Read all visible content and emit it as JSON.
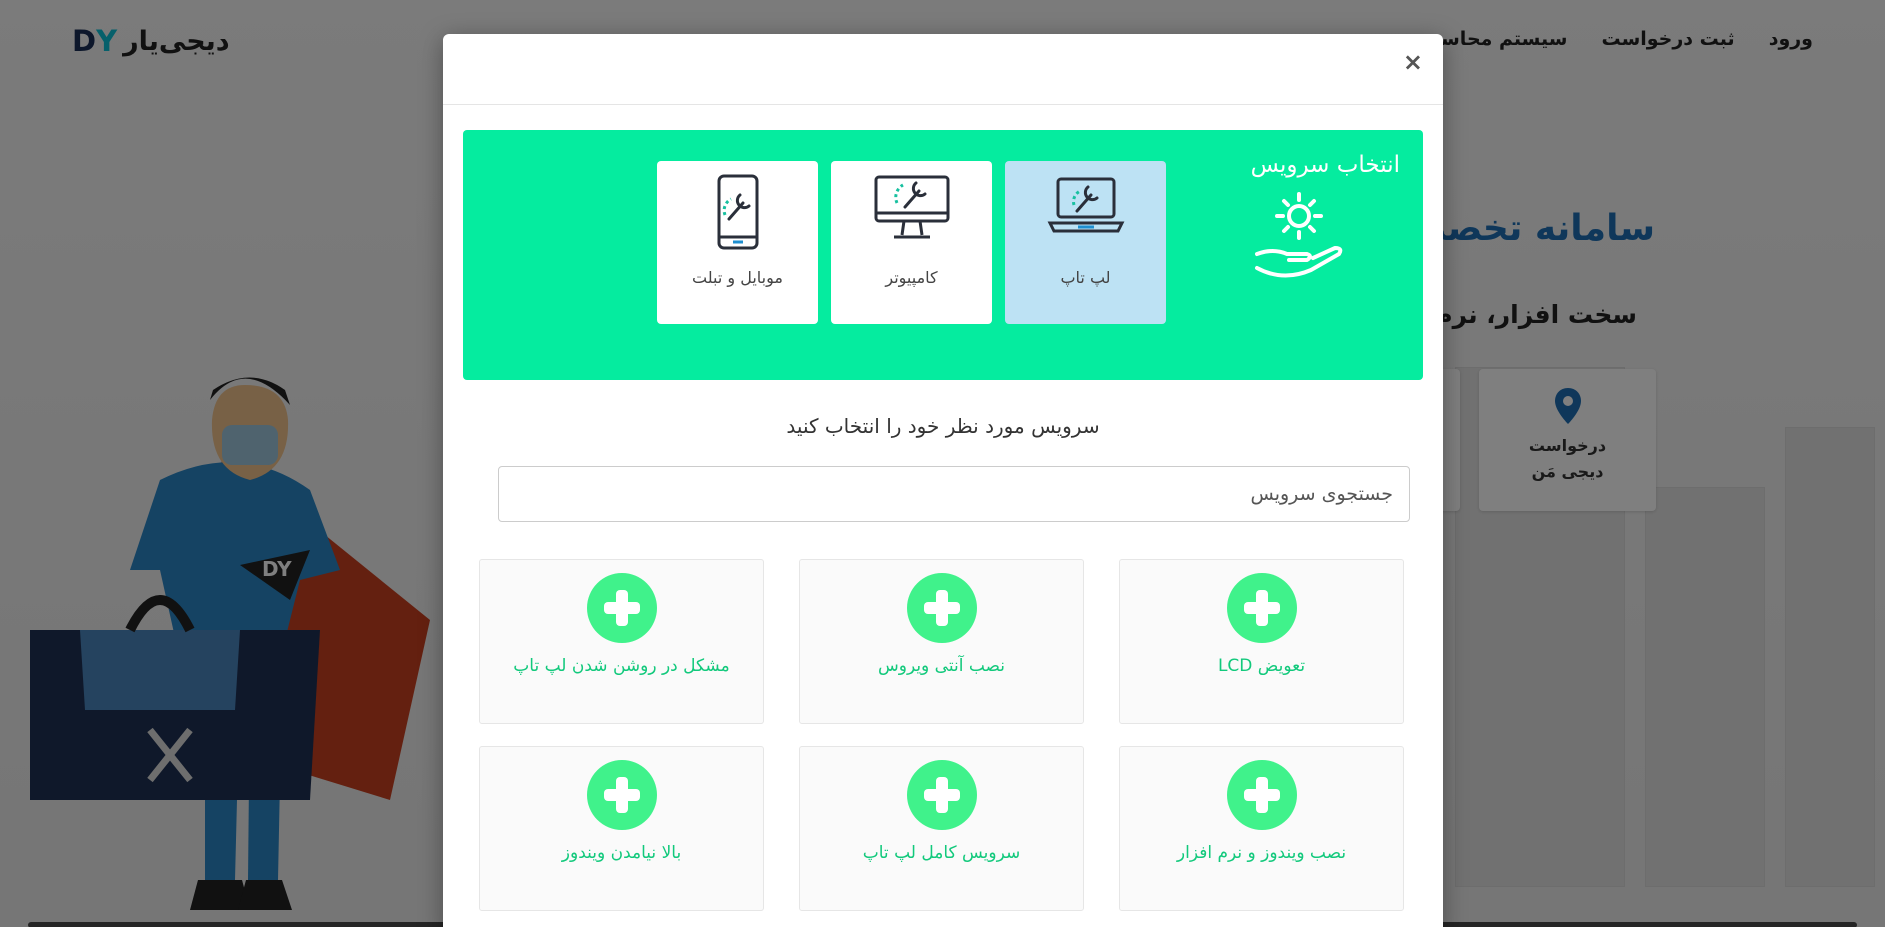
{
  "site": {
    "logo_text": "دیجی‌یار",
    "nav": [
      "ورود",
      "ثبت درخواست",
      "سیستم محاسبه"
    ],
    "hero_title": "سامانه تخصص",
    "hero_subtitle": "سخت افزار، نرم اف",
    "feature_card_label": "درخواست\nدیجی مَن"
  },
  "modal": {
    "close_label": "×",
    "panel_title": "انتخاب سرویس",
    "categories": [
      {
        "label": "لپ تاپ",
        "icon": "laptop-repair-icon",
        "active": true
      },
      {
        "label": "کامپیوتر",
        "icon": "monitor-repair-icon",
        "active": false
      },
      {
        "label": "موبایل و تبلت",
        "icon": "mobile-repair-icon",
        "active": false
      }
    ],
    "prompt": "سرویس مورد نظر خود را انتخاب کنید",
    "search": {
      "placeholder": "جستجوی سرویس",
      "value": ""
    },
    "services": [
      {
        "label": "تعویض LCD"
      },
      {
        "label": "نصب آنتی ویروس"
      },
      {
        "label": "مشکل در روشن شدن لپ تاپ"
      },
      {
        "label": "نصب ویندوز و نرم افزار"
      },
      {
        "label": "سرویس کامل لپ تاپ"
      },
      {
        "label": "بالا نیامدن ویندوز"
      }
    ]
  },
  "colors": {
    "panel": "#05ec9f",
    "active_category": "#bde2f4",
    "plus": "#40f28b",
    "service_label": "#12c97c",
    "hero_title": "#1e6fb5"
  }
}
